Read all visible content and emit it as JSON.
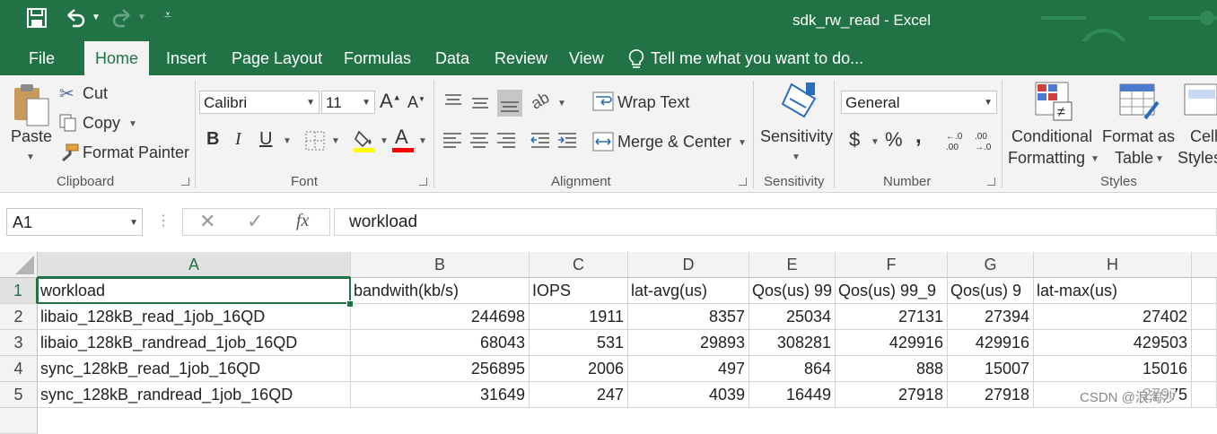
{
  "window": {
    "title": "sdk_rw_read - Excel"
  },
  "quick_access": {
    "save": "save-icon",
    "undo": "undo-icon",
    "redo": "redo-icon",
    "customize": "customize-icon"
  },
  "tabs": [
    "File",
    "Home",
    "Insert",
    "Page Layout",
    "Formulas",
    "Data",
    "Review",
    "View"
  ],
  "tell_me": "Tell me what you want to do...",
  "ribbon": {
    "clipboard": {
      "paste": "Paste",
      "cut": "Cut",
      "copy": "Copy",
      "format_painter": "Format Painter",
      "label": "Clipboard"
    },
    "font": {
      "name": "Calibri",
      "size": "11",
      "bold": "B",
      "italic": "I",
      "underline": "U",
      "label": "Font",
      "fill_color": "#ffff00",
      "font_color": "#ff0000"
    },
    "alignment": {
      "wrap_text": "Wrap Text",
      "merge_center": "Merge & Center",
      "label": "Alignment"
    },
    "sensitivity": {
      "button": "Sensitivity",
      "label": "Sensitivity"
    },
    "number": {
      "format": "General",
      "currency": "$",
      "percent": "%",
      "comma": ",",
      "label": "Number"
    },
    "styles": {
      "conditional_1": "Conditional",
      "conditional_2": "Formatting",
      "format_table_1": "Format as",
      "format_table_2": "Table",
      "cell_styles_1": "Cell",
      "cell_styles_2": "Styles",
      "label": "Styles"
    }
  },
  "formula_bar": {
    "name_box": "A1",
    "fx": "fx",
    "content": "workload"
  },
  "sheet": {
    "columns": [
      "A",
      "B",
      "C",
      "D",
      "E",
      "F",
      "G",
      "H"
    ],
    "rows": [
      "1",
      "2",
      "3",
      "4",
      "5"
    ],
    "header": [
      "workload",
      "bandwith(kb/s)",
      "IOPS",
      "lat-avg(us)",
      "Qos(us) 99",
      "Qos(us) 99_9",
      "Qos(us) 9",
      "lat-max(us)"
    ],
    "data": [
      [
        "libaio_128kB_read_1job_16QD",
        "244698",
        "1911",
        "8357",
        "25034",
        "27131",
        "27394",
        "27402"
      ],
      [
        "libaio_128kB_randread_1job_16QD",
        "68043",
        "531",
        "29893",
        "308281",
        "429916",
        "429916",
        "429503"
      ],
      [
        "sync_128kB_read_1job_16QD",
        "256895",
        "2006",
        "497",
        "864",
        "888",
        "15007",
        "15016"
      ],
      [
        "sync_128kB_randread_1job_16QD",
        "31649",
        "247",
        "4039",
        "16449",
        "27918",
        "27918",
        "27975"
      ]
    ]
  },
  "watermark": "CSDN @浪淘沙",
  "colors": {
    "excel_green": "#217346",
    "ribbon_bg": "#f3f3f3"
  }
}
